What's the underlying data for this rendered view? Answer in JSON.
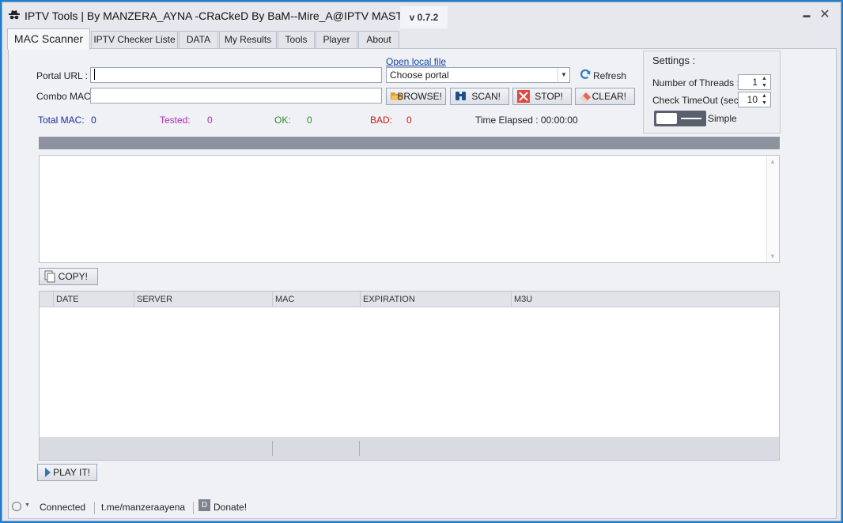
{
  "window": {
    "title": "IPTV Tools | By MANZERA_AYNA -CRaCkeD By BaM--Mire_A@IPTV MASTERS",
    "version": "v 0.7.2",
    "minimize_glyph": "▬",
    "close_glyph": "✕"
  },
  "tabs": [
    {
      "label": "MAC Scanner",
      "active": true
    },
    {
      "label": "IPTV Checker Liste"
    },
    {
      "label": "DATA"
    },
    {
      "label": "My Results"
    },
    {
      "label": "Tools"
    },
    {
      "label": "Player"
    },
    {
      "label": "About"
    }
  ],
  "form": {
    "portal_url_label": "Portal URL :",
    "portal_url_value": "",
    "combo_mac_label": "Combo MAC :",
    "combo_mac_value": "",
    "open_local_file": "Open local file",
    "portal_select": "Choose portal",
    "refresh": "Refresh"
  },
  "buttons": {
    "browse": "BROWSE!",
    "scan": "SCAN!",
    "stop": "STOP!",
    "clear": "CLEAR!",
    "copy": "COPY!",
    "play": "PLAY IT!"
  },
  "stats": {
    "total_label": "Total MAC:",
    "total_value": "0",
    "tested_label": "Tested:",
    "tested_value": "0",
    "ok_label": "OK:",
    "ok_value": "0",
    "bad_label": "BAD:",
    "bad_value": "0",
    "elapsed": "Time Elapsed : 00:00:00"
  },
  "settings": {
    "title": "Settings :",
    "threads_label": "Number of Threads :",
    "threads_value": "1",
    "timeout_label": "Check TimeOut (sec) :",
    "timeout_value": "10",
    "mode_label": "Simple"
  },
  "progress": 0,
  "results_table": {
    "columns": [
      "DATE",
      "SERVER",
      "MAC",
      "EXPIRATION",
      "M3U"
    ],
    "rows": []
  },
  "statusbar": {
    "connection": "Connected",
    "telegram": "t.me/manzeraayena",
    "donate_badge": "D",
    "donate": "Donate!"
  },
  "colors": {
    "total": "#1b2fa0",
    "tested": "#b02ab8",
    "ok": "#2b8a2b",
    "bad": "#d01818",
    "link": "#1346a8"
  }
}
